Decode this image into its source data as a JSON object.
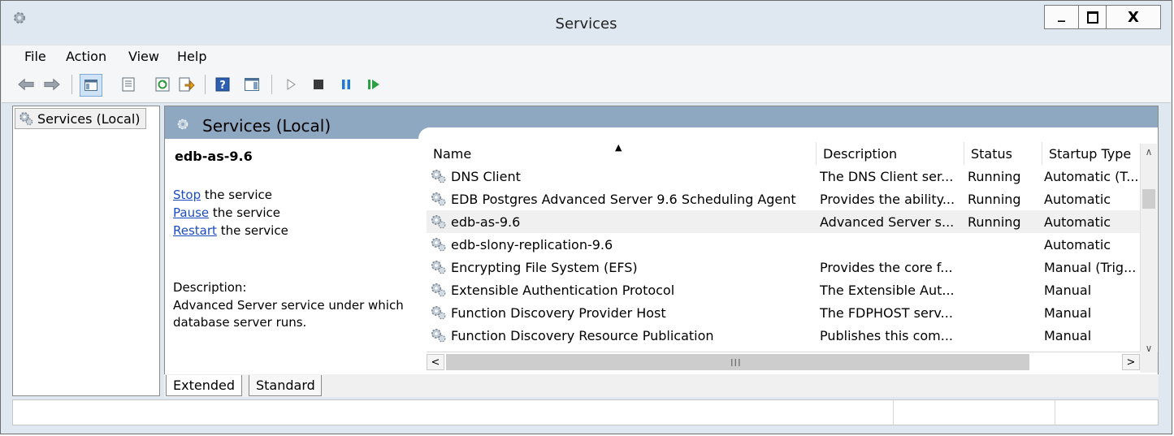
{
  "window": {
    "title": "Services",
    "controls": {
      "minimize": "_",
      "maximize": "☐",
      "close": "X"
    }
  },
  "menu": [
    "File",
    "Action",
    "View",
    "Help"
  ],
  "tree": {
    "root_label": "Services (Local)"
  },
  "panel": {
    "header_title": "Services (Local)",
    "selected_service": "edb-as-9.6",
    "actions": [
      {
        "link": "Stop",
        "suffix": " the service"
      },
      {
        "link": "Pause",
        "suffix": " the service"
      },
      {
        "link": "Restart",
        "suffix": " the service"
      }
    ],
    "description_label": "Description:",
    "description_text": "Advanced Server service under which database server runs."
  },
  "list": {
    "columns": [
      "Name",
      "Description",
      "Status",
      "Startup Type"
    ],
    "rows": [
      {
        "name": "DNS Client",
        "description": "The DNS Client ser...",
        "status": "Running",
        "startup": "Automatic (T..."
      },
      {
        "name": "EDB Postgres Advanced Server 9.6 Scheduling Agent",
        "description": "Provides the ability...",
        "status": "Running",
        "startup": "Automatic"
      },
      {
        "name": "edb-as-9.6",
        "description": "Advanced Server s...",
        "status": "Running",
        "startup": "Automatic"
      },
      {
        "name": "edb-slony-replication-9.6",
        "description": "",
        "status": "",
        "startup": "Automatic"
      },
      {
        "name": "Encrypting File System (EFS)",
        "description": "Provides the core f...",
        "status": "",
        "startup": "Manual (Trig..."
      },
      {
        "name": "Extensible Authentication Protocol",
        "description": "The Extensible Aut...",
        "status": "",
        "startup": "Manual"
      },
      {
        "name": "Function Discovery Provider Host",
        "description": "The FDPHOST serv...",
        "status": "",
        "startup": "Manual"
      },
      {
        "name": "Function Discovery Resource Publication",
        "description": "Publishes this com...",
        "status": "",
        "startup": "Manual"
      }
    ],
    "selected_index": 2,
    "hscroll_grip": "III"
  },
  "tabs": [
    "Extended",
    "Standard"
  ],
  "colors": {
    "header_band": "#8fa8c2",
    "chrome": "#dfe8f1",
    "link": "#1a4dc0",
    "play_green": "#2ea043",
    "pause_blue": "#1e7bd6"
  },
  "icons": {
    "toolbar": [
      "back-arrow-icon",
      "forward-arrow-icon",
      "show-hide-console-tree-icon",
      "properties-icon",
      "refresh-icon",
      "export-list-icon",
      "help-icon",
      "show-action-pane-icon",
      "start-service-icon",
      "stop-service-icon",
      "pause-service-icon",
      "resume-service-icon"
    ],
    "service": "gear-icon"
  }
}
